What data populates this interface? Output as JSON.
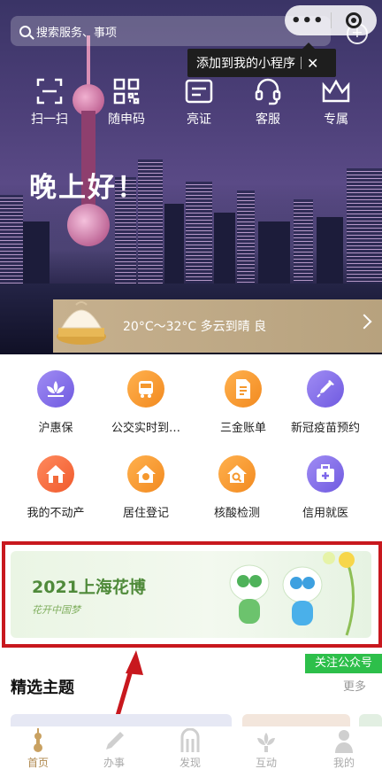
{
  "search": {
    "placeholder": "搜索服务、事项"
  },
  "capsule": {
    "more_glyph": "•••"
  },
  "tooltip": {
    "text": "添加到我的小程序",
    "close_glyph": "✕"
  },
  "quick_actions": [
    {
      "label": "扫一扫",
      "icon": "scan-icon"
    },
    {
      "label": "随申码",
      "icon": "qr-code-icon"
    },
    {
      "label": "亮证",
      "icon": "card-icon"
    },
    {
      "label": "客服",
      "icon": "headset-icon"
    },
    {
      "label": "专属",
      "icon": "crown-icon"
    }
  ],
  "greeting": "晚上好！",
  "weather": {
    "text": "20°C～32°C 多云到晴 良"
  },
  "services": [
    {
      "label": "沪惠保",
      "icon": "lotus-icon",
      "color": "#7c66ea"
    },
    {
      "label": "公交实时到…",
      "icon": "bus-icon",
      "color": "#f5982e"
    },
    {
      "label": "三金账单",
      "icon": "document-icon",
      "color": "#f5982e"
    },
    {
      "label": "新冠疫苗预约",
      "icon": "syringe-icon",
      "color": "#7c66ea"
    },
    {
      "label": "我的不动产",
      "icon": "house-icon",
      "color": "#f26a3a"
    },
    {
      "label": "居住登记",
      "icon": "home-check-icon",
      "color": "#f5982e"
    },
    {
      "label": "核酸检测",
      "icon": "house-search-icon",
      "color": "#f5982e"
    },
    {
      "label": "信用就医",
      "icon": "medical-kit-icon",
      "color": "#7c66ea"
    }
  ],
  "banner": {
    "title": "2021上海花博",
    "subtitle": "花开中国梦"
  },
  "follow_button": "关注公众号",
  "section": {
    "title": "精选主题",
    "more": "更多"
  },
  "tabs": [
    {
      "label": "首页",
      "icon": "home-tower-icon",
      "active": true
    },
    {
      "label": "办事",
      "icon": "pen-icon",
      "active": false
    },
    {
      "label": "发现",
      "icon": "discover-icon",
      "active": false
    },
    {
      "label": "互动",
      "icon": "interact-icon",
      "active": false
    },
    {
      "label": "我的",
      "icon": "profile-icon",
      "active": false
    }
  ],
  "colors": {
    "accent": "#b08a50",
    "annotation_red": "#c8181e",
    "follow_green": "#2dbf4a"
  }
}
